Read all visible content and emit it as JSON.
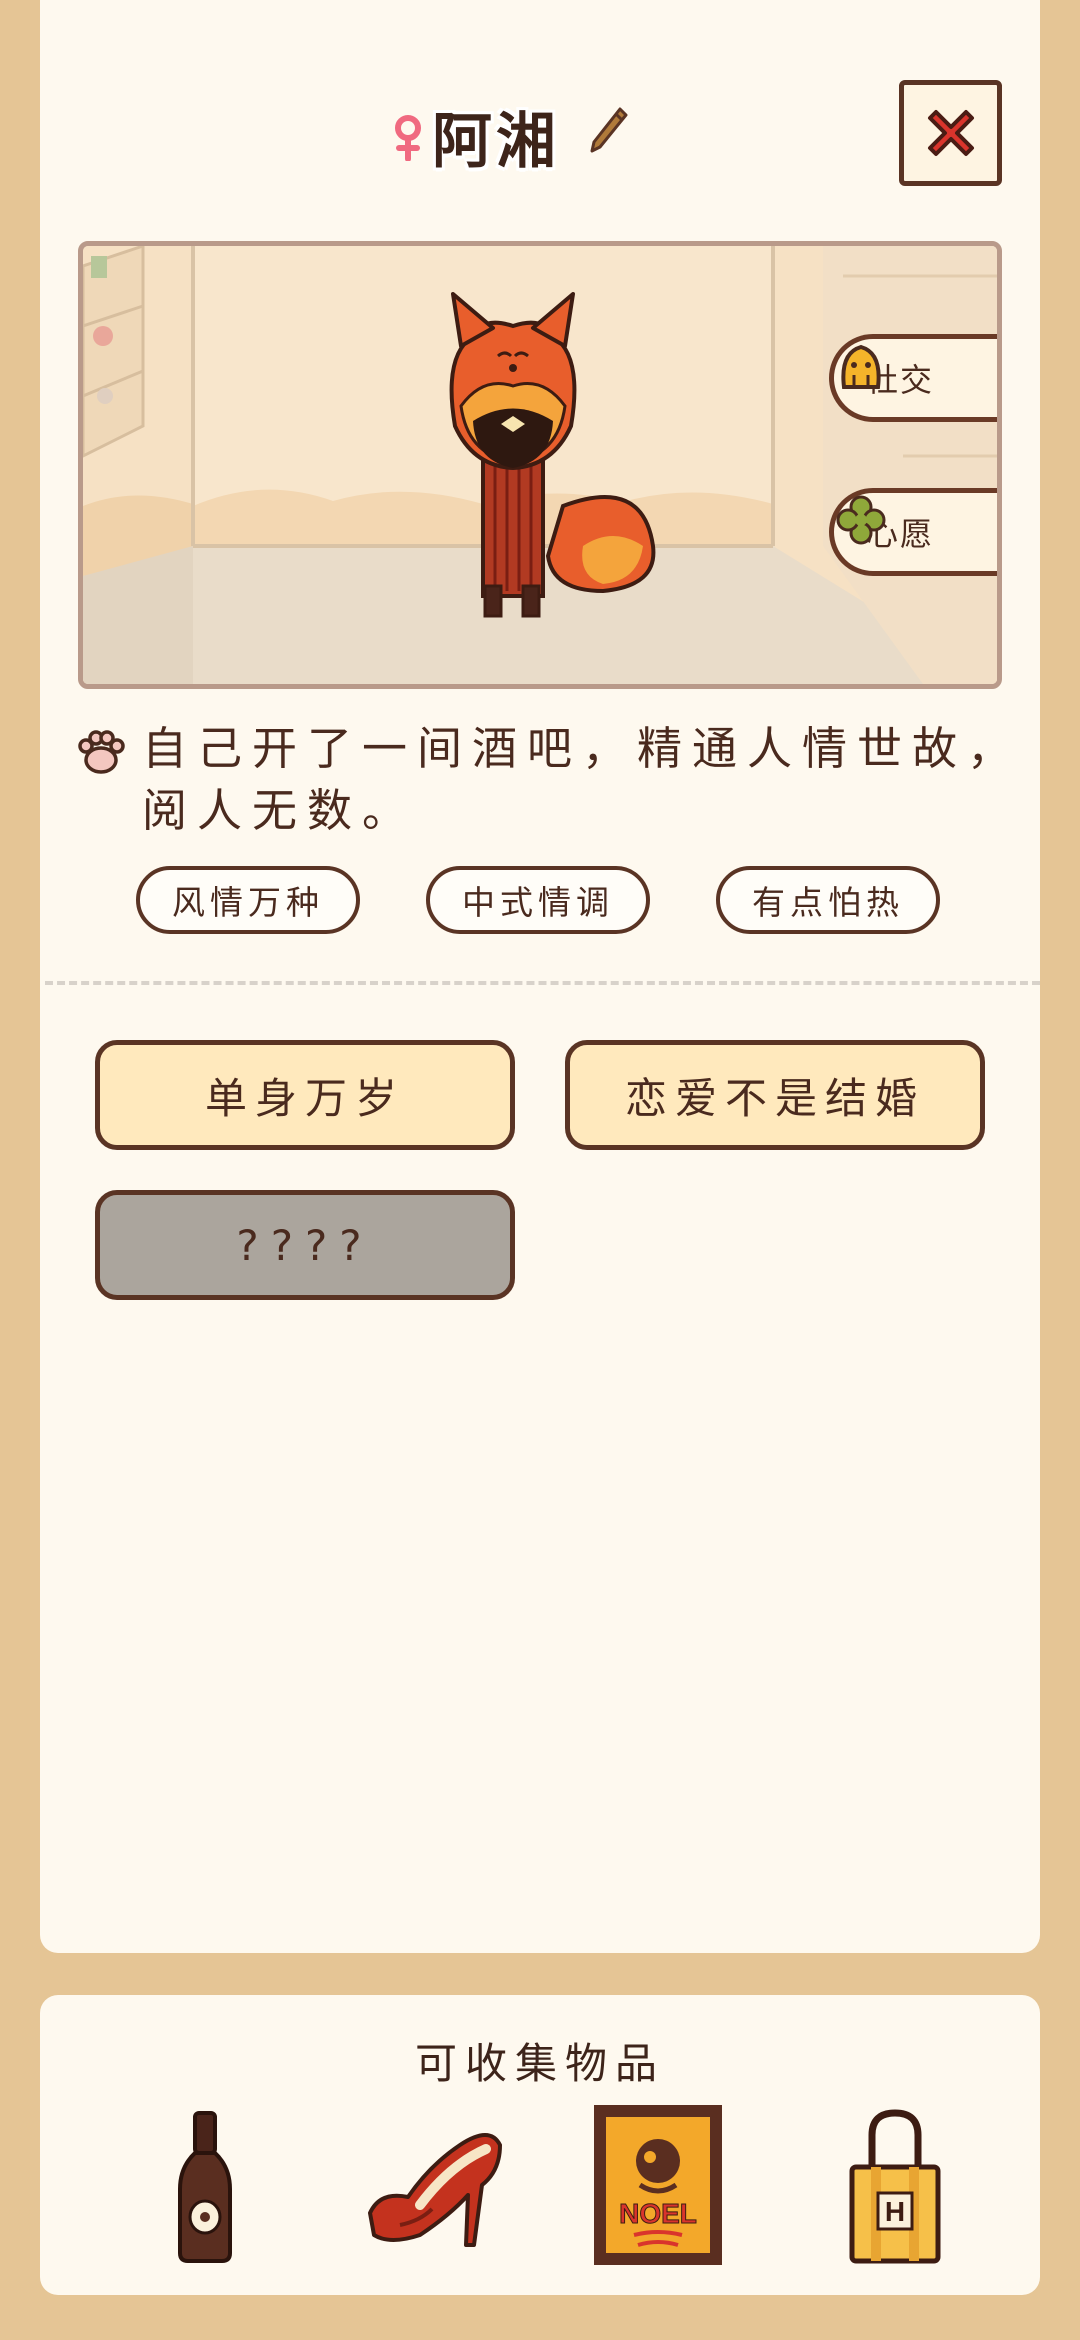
{
  "character": {
    "name": "阿湘"
  },
  "scene": {
    "buttons": [
      {
        "label": "社交"
      },
      {
        "label": "心愿"
      }
    ]
  },
  "description": "自己开了一间酒吧，精通人情世故，阅人无数。",
  "tags": [
    "风情万种",
    "中式情调",
    "有点怕热"
  ],
  "options": [
    "单身万岁",
    "恋爱不是结婚",
    "????"
  ],
  "collectibles": {
    "title": "可收集物品",
    "items": [
      "bottle-icon",
      "high-heels-icon",
      "noel-poster-icon",
      "shopping-bag-icon"
    ],
    "poster_text": "NOEL",
    "bag_letter": "H"
  },
  "colors": {
    "background": "#E5C595",
    "card": "#FEF9EF",
    "border_brown": "#5A3424",
    "option_fill": "#FFE9BD",
    "locked_fill": "#ABA59D",
    "fox_orange": "#E0502A"
  }
}
